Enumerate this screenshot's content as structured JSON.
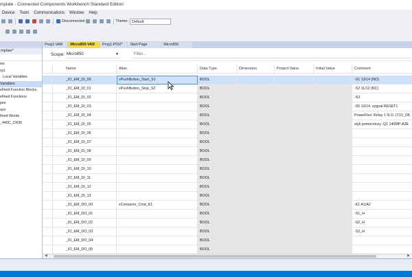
{
  "window": {
    "title": "mplate - Connected Components Workbench Standard Edition"
  },
  "menu": [
    "Device",
    "Tools",
    "Communications",
    "Window",
    "Help"
  ],
  "toolbar": {
    "connection_status": "Disconnected",
    "theme_label": "Theme:",
    "theme_value": "Default"
  },
  "project": {
    "name": "mplate*",
    "tree": [
      "ws",
      "rg1",
      "Local Variables",
      "Variables",
      "efined Function Blocks",
      "efined Functions",
      "pes",
      "ays",
      "fined Words",
      "_440C_CR30"
    ],
    "selected_index": 3
  },
  "tabs": [
    "Prog1-VAR",
    "Micro850-VAR",
    "Prog1-POU*",
    "Start Page",
    "Micro850"
  ],
  "active_tab": 1,
  "scope": {
    "label": "Scope:",
    "value": "Micro850",
    "filter_placeholder": "Filter..."
  },
  "grid": {
    "columns": [
      "Name",
      "Alias",
      "Data Type",
      "Dimension",
      "Project Value",
      "Initial Value",
      "Comment"
    ],
    "rows": [
      {
        "name": "_IO_EM_DI_00",
        "alias": "xPushButton_Start_S1",
        "type": "BOOL",
        "comment": "-S1 13/14 (NO)"
      },
      {
        "name": "_IO_EM_DI_01",
        "alias": "xPushButton_Stop_S2",
        "type": "BOOL",
        "comment": "-S2 11/12 (NC)"
      },
      {
        "name": "_IO_EM_DI_02",
        "alias": "",
        "type": "BOOL",
        "comment": "-S3"
      },
      {
        "name": "_IO_EM_DI_03",
        "alias": "",
        "type": "BOOL",
        "comment": "-S5 13/14, sygnał RESET1"
      },
      {
        "name": "_IO_EM_DI_04",
        "alias": "",
        "type": "BOOL",
        "comment": "PowerFlex: Relay 1 N.O. (T10_OK"
      },
      {
        "name": "_IO_EM_DI_05",
        "alias": "",
        "type": "BOOL",
        "comment": "styk pomocniczy -Q1 140MP-A3E"
      },
      {
        "name": "_IO_EM_DI_06",
        "alias": "",
        "type": "BOOL",
        "comment": ""
      },
      {
        "name": "_IO_EM_DI_07",
        "alias": "",
        "type": "BOOL",
        "comment": ""
      },
      {
        "name": "_IO_EM_DI_08",
        "alias": "",
        "type": "BOOL",
        "comment": ""
      },
      {
        "name": "_IO_EM_DI_09",
        "alias": "",
        "type": "BOOL",
        "comment": ""
      },
      {
        "name": "_IO_EM_DI_10",
        "alias": "",
        "type": "BOOL",
        "comment": ""
      },
      {
        "name": "_IO_EM_DI_11",
        "alias": "",
        "type": "BOOL",
        "comment": ""
      },
      {
        "name": "_IO_EM_DI_12",
        "alias": "",
        "type": "BOOL",
        "comment": ""
      },
      {
        "name": "_IO_EM_DI_13",
        "alias": "",
        "type": "BOOL",
        "comment": ""
      },
      {
        "name": "_IO_EM_DO_00",
        "alias": "xContactor_Cmd_K1",
        "type": "BOOL",
        "comment": "-K1 A1/A2"
      },
      {
        "name": "_IO_EM_DO_01",
        "alias": "",
        "type": "BOOL",
        "comment": "-S1_H"
      },
      {
        "name": "_IO_EM_DO_02",
        "alias": "",
        "type": "BOOL",
        "comment": "-S2_H"
      },
      {
        "name": "_IO_EM_DO_03",
        "alias": "",
        "type": "BOOL",
        "comment": "-S3_H"
      },
      {
        "name": "_IO_EM_DO_04",
        "alias": "",
        "type": "BOOL",
        "comment": ""
      },
      {
        "name": "_IO_EM_DO_05",
        "alias": "",
        "type": "BOOL",
        "comment": ""
      }
    ],
    "selected_row": 0
  },
  "colors": {
    "accent": "#0078d7",
    "active_tab": "#f5d94b",
    "selection": "#cde1f8"
  }
}
